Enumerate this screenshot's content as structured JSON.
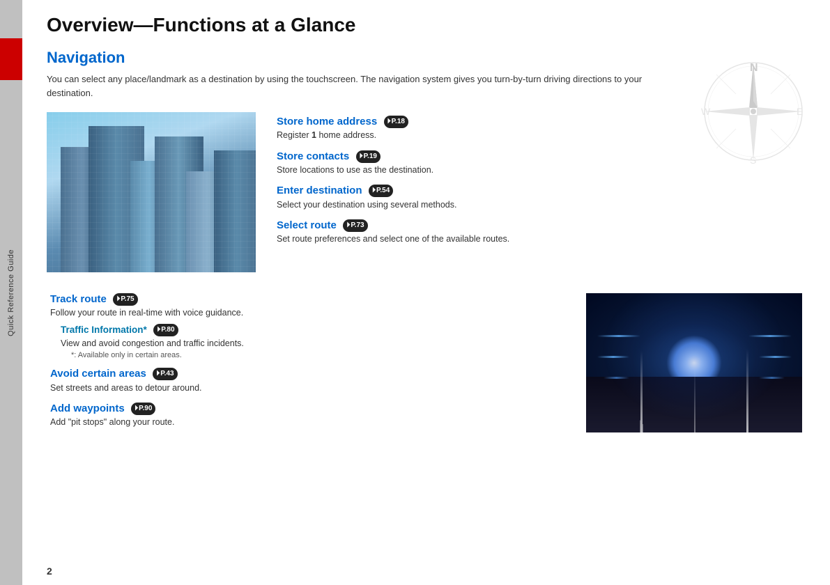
{
  "sidebar": {
    "label": "Quick Reference Guide"
  },
  "page": {
    "title": "Overview—Functions at a Glance",
    "number": "2"
  },
  "navigation": {
    "section_title": "Navigation",
    "intro": "You can select any place/landmark as a destination by using the touchscreen. The navigation system gives you turn-by-turn driving directions to your destination.",
    "features_upper": [
      {
        "title": "Store home address",
        "badge": "P.18",
        "desc": "Register 1 home address."
      },
      {
        "title": "Store contacts",
        "badge": "P.19",
        "desc": "Store locations to use as the destination."
      },
      {
        "title": "Enter destination",
        "badge": "P.54",
        "desc": "Select your destination using several methods."
      },
      {
        "title": "Select route",
        "badge": "P.73",
        "desc": "Set route preferences and select one of the available routes."
      }
    ],
    "features_lower": [
      {
        "title": "Track route",
        "badge": "P.75",
        "desc": "Follow your route in real-time with voice guidance.",
        "sub": [
          {
            "title": "Traffic Information*",
            "badge": "P.80",
            "desc": "View and avoid congestion and traffic incidents.",
            "note": "*: Available only in certain areas."
          }
        ]
      },
      {
        "title": "Avoid certain areas",
        "badge": "P.43",
        "desc": "Set streets and areas to detour around."
      },
      {
        "title": "Add waypoints",
        "badge": "P.90",
        "desc": "Add \"pit stops\" along your route."
      }
    ]
  }
}
